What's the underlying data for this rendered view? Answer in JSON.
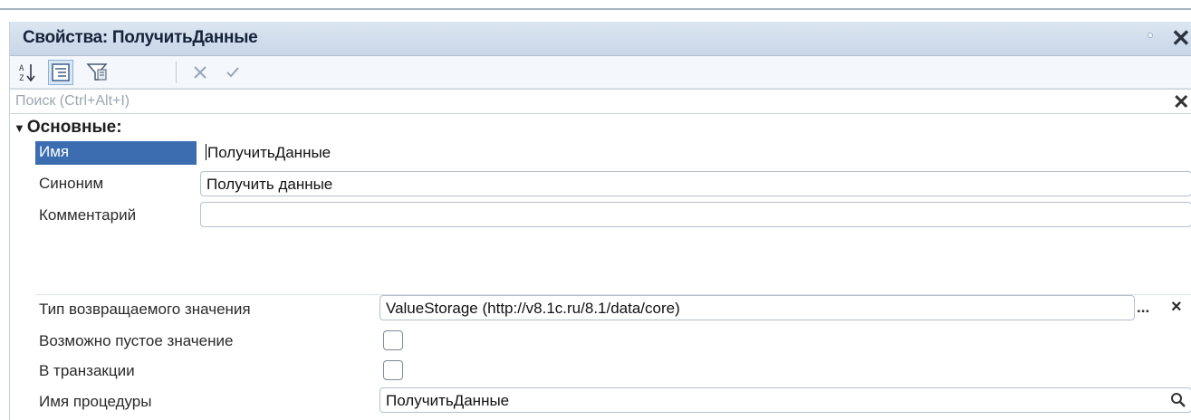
{
  "window": {
    "title": "Свойства: ПолучитьДанные"
  },
  "toolbar": {
    "buttons": [
      "sort-alphabetical-icon",
      "group-categories-icon",
      "filter-icon",
      "delete-icon",
      "check-icon"
    ]
  },
  "search": {
    "placeholder": "Поиск (Ctrl+Alt+I)",
    "value": ""
  },
  "group": {
    "label": "Основные:"
  },
  "properties": {
    "name": {
      "label": "Имя",
      "value": "ПолучитьДанные"
    },
    "synonym": {
      "label": "Синоним",
      "value": "Получить данные"
    },
    "comment": {
      "label": "Комментарий",
      "value": ""
    },
    "return_type": {
      "label": "Тип возвращаемого значения",
      "value": "ValueStorage (http://v8.1c.ru/8.1/data/core)",
      "choose_label": "...",
      "clear_label": "×"
    },
    "nullable": {
      "label": "Возможно пустое значение",
      "checked": false
    },
    "transaction": {
      "label": "В транзакции",
      "checked": false
    },
    "procedure": {
      "label": "Имя процедуры",
      "value": "ПолучитьДанные"
    }
  },
  "colors": {
    "selection": "#3b6db0",
    "titlebar": "#c8d6e8"
  }
}
